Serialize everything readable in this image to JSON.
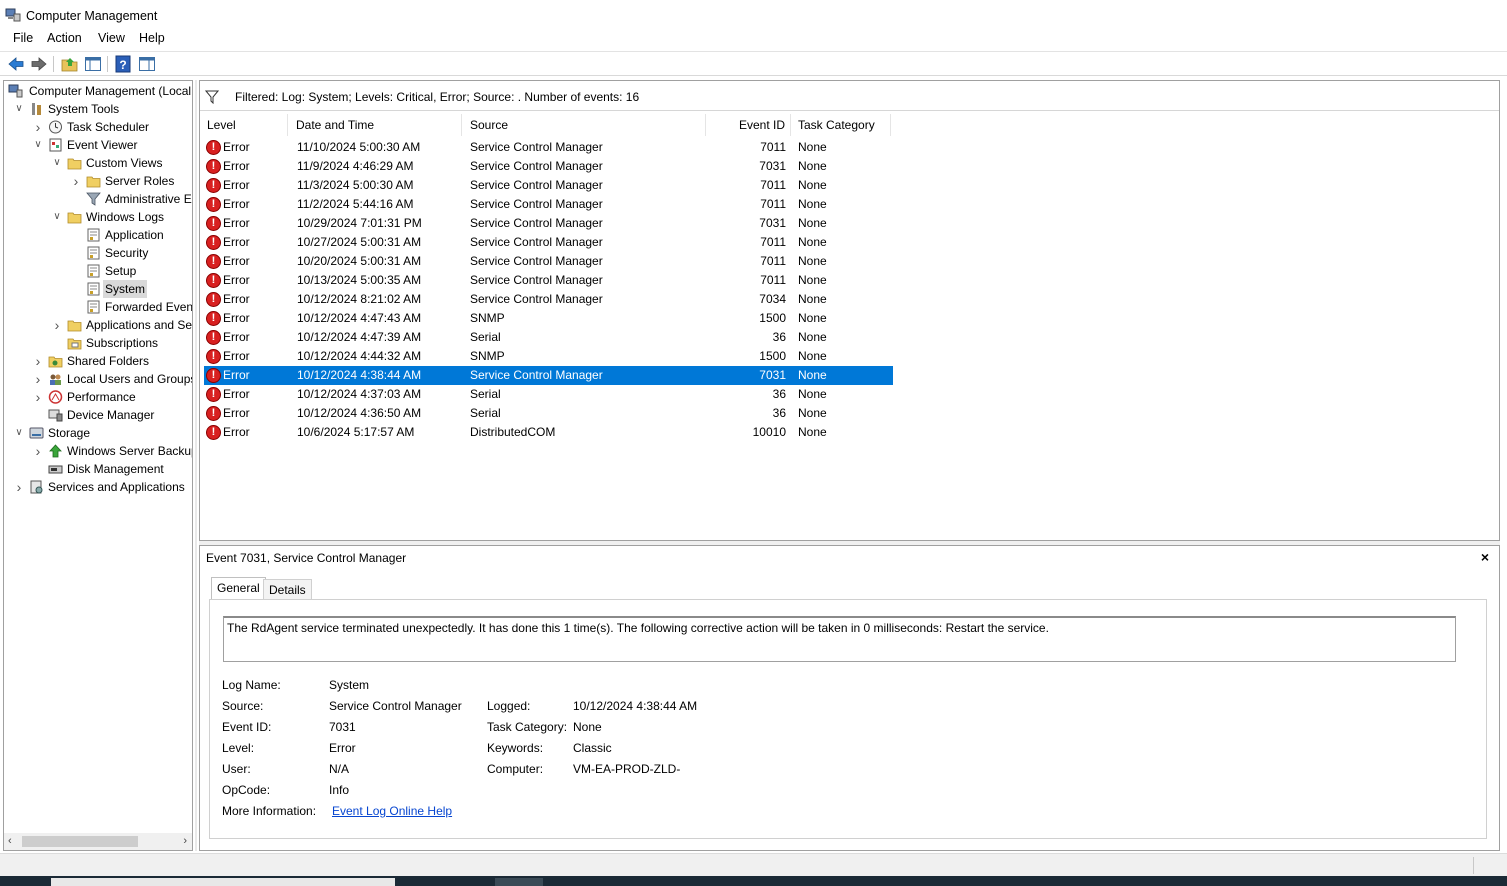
{
  "window": {
    "title": "Computer Management"
  },
  "menu": [
    "File",
    "Action",
    "View",
    "Help"
  ],
  "toolbar": {
    "icons": [
      "back-arrow-icon",
      "forward-arrow-icon",
      "up-folder-icon",
      "show-hide-tree-icon",
      "help-icon",
      "action-pane-icon"
    ]
  },
  "tree": {
    "items": [
      {
        "label": "Computer Management (Local",
        "icon": "computer-management-icon",
        "level": 0,
        "expanded": null
      },
      {
        "label": "System Tools",
        "icon": "system-tools-icon",
        "level": 1,
        "expanded": true
      },
      {
        "label": "Task Scheduler",
        "icon": "clock-icon",
        "level": 2,
        "expanded": false
      },
      {
        "label": "Event Viewer",
        "icon": "event-viewer-icon",
        "level": 2,
        "expanded": true
      },
      {
        "label": "Custom Views",
        "icon": "folder-icon",
        "level": 3,
        "expanded": true
      },
      {
        "label": "Server Roles",
        "icon": "folder-icon",
        "level": 4,
        "expanded": false
      },
      {
        "label": "Administrative E",
        "icon": "filter-icon",
        "level": 4,
        "expanded": null
      },
      {
        "label": "Windows Logs",
        "icon": "folder-icon",
        "level": 3,
        "expanded": true
      },
      {
        "label": "Application",
        "icon": "log-icon",
        "level": 4,
        "expanded": null
      },
      {
        "label": "Security",
        "icon": "log-icon",
        "level": 4,
        "expanded": null
      },
      {
        "label": "Setup",
        "icon": "log-icon",
        "level": 4,
        "expanded": null
      },
      {
        "label": "System",
        "icon": "log-icon",
        "level": 4,
        "expanded": null,
        "selected": true
      },
      {
        "label": "Forwarded Event",
        "icon": "log-icon",
        "level": 4,
        "expanded": null
      },
      {
        "label": "Applications and Se",
        "icon": "folder-icon",
        "level": 3,
        "expanded": false
      },
      {
        "label": "Subscriptions",
        "icon": "subscriptions-icon",
        "level": 3,
        "expanded": null
      },
      {
        "label": "Shared Folders",
        "icon": "shared-folders-icon",
        "level": 2,
        "expanded": false
      },
      {
        "label": "Local Users and Groups",
        "icon": "users-icon",
        "level": 2,
        "expanded": false
      },
      {
        "label": "Performance",
        "icon": "performance-icon",
        "level": 2,
        "expanded": false
      },
      {
        "label": "Device Manager",
        "icon": "device-manager-icon",
        "level": 2,
        "expanded": null
      },
      {
        "label": "Storage",
        "icon": "storage-icon",
        "level": 1,
        "expanded": true
      },
      {
        "label": "Windows Server Backup",
        "icon": "backup-icon",
        "level": 2,
        "expanded": false
      },
      {
        "label": "Disk Management",
        "icon": "disk-icon",
        "level": 2,
        "expanded": null
      },
      {
        "label": "Services and Applications",
        "icon": "services-icon",
        "level": 1,
        "expanded": false
      }
    ]
  },
  "filter": {
    "text": "Filtered: Log: System; Levels: Critical, Error; Source: . Number of events: 16"
  },
  "columns": [
    "Level",
    "Date and Time",
    "Source",
    "Event ID",
    "Task Category"
  ],
  "events": [
    {
      "level": "Error",
      "datetime": "11/10/2024 5:00:30 AM",
      "source": "Service Control Manager",
      "event_id": "7011",
      "category": "None"
    },
    {
      "level": "Error",
      "datetime": "11/9/2024 4:46:29 AM",
      "source": "Service Control Manager",
      "event_id": "7031",
      "category": "None"
    },
    {
      "level": "Error",
      "datetime": "11/3/2024 5:00:30 AM",
      "source": "Service Control Manager",
      "event_id": "7011",
      "category": "None"
    },
    {
      "level": "Error",
      "datetime": "11/2/2024 5:44:16 AM",
      "source": "Service Control Manager",
      "event_id": "7011",
      "category": "None"
    },
    {
      "level": "Error",
      "datetime": "10/29/2024 7:01:31 PM",
      "source": "Service Control Manager",
      "event_id": "7031",
      "category": "None"
    },
    {
      "level": "Error",
      "datetime": "10/27/2024 5:00:31 AM",
      "source": "Service Control Manager",
      "event_id": "7011",
      "category": "None"
    },
    {
      "level": "Error",
      "datetime": "10/20/2024 5:00:31 AM",
      "source": "Service Control Manager",
      "event_id": "7011",
      "category": "None"
    },
    {
      "level": "Error",
      "datetime": "10/13/2024 5:00:35 AM",
      "source": "Service Control Manager",
      "event_id": "7011",
      "category": "None"
    },
    {
      "level": "Error",
      "datetime": "10/12/2024 8:21:02 AM",
      "source": "Service Control Manager",
      "event_id": "7034",
      "category": "None"
    },
    {
      "level": "Error",
      "datetime": "10/12/2024 4:47:43 AM",
      "source": "SNMP",
      "event_id": "1500",
      "category": "None"
    },
    {
      "level": "Error",
      "datetime": "10/12/2024 4:47:39 AM",
      "source": "Serial",
      "event_id": "36",
      "category": "None"
    },
    {
      "level": "Error",
      "datetime": "10/12/2024 4:44:32 AM",
      "source": "SNMP",
      "event_id": "1500",
      "category": "None"
    },
    {
      "level": "Error",
      "datetime": "10/12/2024 4:38:44 AM",
      "source": "Service Control Manager",
      "event_id": "7031",
      "category": "None",
      "selected": true
    },
    {
      "level": "Error",
      "datetime": "10/12/2024 4:37:03 AM",
      "source": "Serial",
      "event_id": "36",
      "category": "None"
    },
    {
      "level": "Error",
      "datetime": "10/12/2024 4:36:50 AM",
      "source": "Serial",
      "event_id": "36",
      "category": "None"
    },
    {
      "level": "Error",
      "datetime": "10/6/2024 5:17:57 AM",
      "source": "DistributedCOM",
      "event_id": "10010",
      "category": "None"
    }
  ],
  "detail": {
    "title": "Event 7031, Service Control Manager",
    "close": "×",
    "tabs": [
      "General",
      "Details"
    ],
    "description": "The RdAgent service terminated unexpectedly.  It has done this 1 time(s).  The following corrective action will be taken in 0 milliseconds: Restart the service.",
    "left_fields": [
      {
        "label": "Log Name:",
        "value": "System"
      },
      {
        "label": "Source:",
        "value": "Service Control Manager"
      },
      {
        "label": "Event ID:",
        "value": "7031"
      },
      {
        "label": "Level:",
        "value": "Error"
      },
      {
        "label": "User:",
        "value": "N/A"
      },
      {
        "label": "OpCode:",
        "value": "Info"
      },
      {
        "label": "More Information:",
        "value": "Event Log Online Help"
      }
    ],
    "right_fields": [
      {
        "label": "Logged:",
        "value": "10/12/2024 4:38:44 AM"
      },
      {
        "label": "Task Category:",
        "value": "None"
      },
      {
        "label": "Keywords:",
        "value": "Classic"
      },
      {
        "label": "Computer:",
        "value": "VM-EA-PROD-ZLD-"
      }
    ]
  },
  "colors": {
    "selection": "#0078d7",
    "error": "#d82020",
    "link": "#0645d0"
  }
}
